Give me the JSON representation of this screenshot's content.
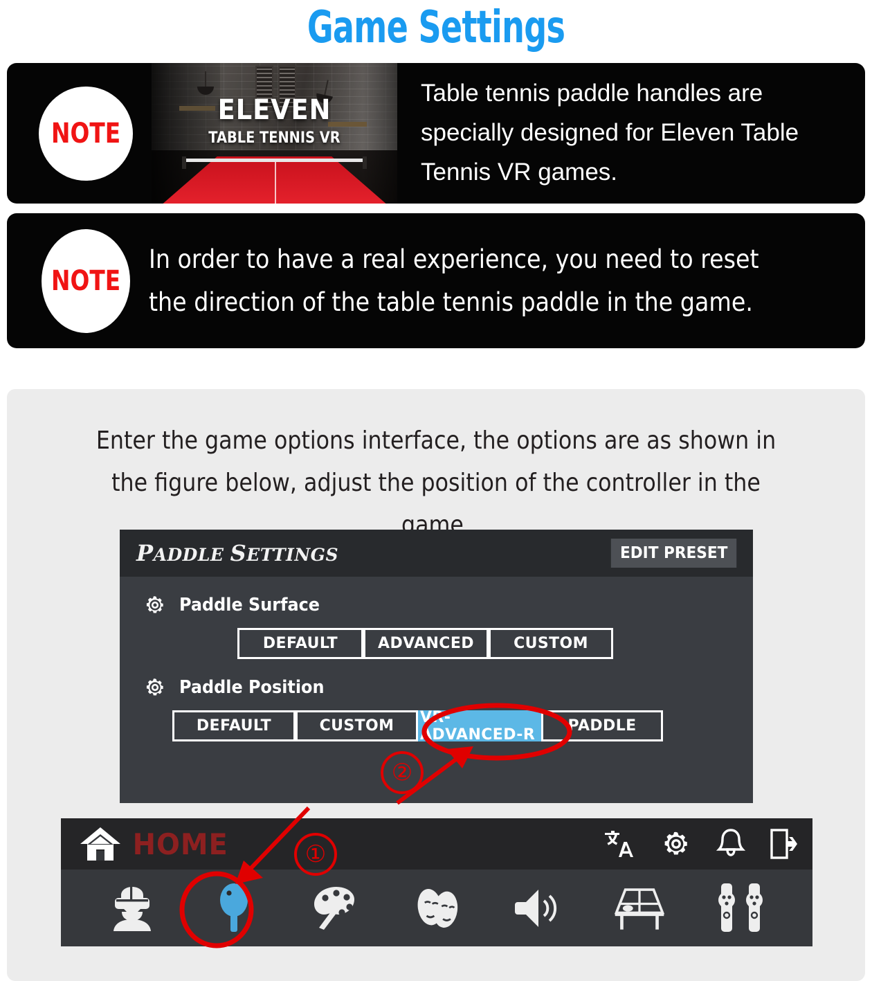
{
  "title": "Game Settings",
  "title_color": "#1a9bf0",
  "notes": [
    {
      "badge": "NOTE",
      "thumbnail": {
        "title": "ELEVEN",
        "subtitle": "TABLE TENNIS VR"
      },
      "text": "Table tennis paddle handles are specially designed for Eleven Table Tennis VR games."
    },
    {
      "badge": "NOTE",
      "text": "In order to have a real experience, you need to reset the direction of the table tennis paddle in the game."
    }
  ],
  "intro_text": "Enter the game options interface, the options are as shown in the figure below, adjust the position of the controller in the game.",
  "panel": {
    "title_part1": "P",
    "title_part2": "ADDLE ",
    "title_part3": "S",
    "title_part4": "ETTINGS",
    "title_full": "PADDLE SETTINGS",
    "edit_preset": "EDIT PRESET",
    "rows": [
      {
        "icon": "gear-icon",
        "label": "Paddle Surface",
        "options": [
          {
            "label": "DEFAULT",
            "selected": false
          },
          {
            "label": "ADVANCED",
            "selected": false
          },
          {
            "label": "CUSTOM",
            "selected": false
          }
        ]
      },
      {
        "icon": "gear-icon",
        "label": "Paddle Position",
        "options": [
          {
            "label": "DEFAULT",
            "selected": false
          },
          {
            "label": "CUSTOM",
            "selected": false
          },
          {
            "label": "VR-ADVANCED-R",
            "selected": true
          },
          {
            "label": "PADDLE",
            "selected": false
          }
        ]
      }
    ],
    "selected_color": "#5cb8e6"
  },
  "homebar": {
    "home_label": "HOME",
    "home_label_color": "#8d2020",
    "top_icons": [
      "translate-icon",
      "gear-icon",
      "bell-icon",
      "exit-icon"
    ],
    "bottom_icons": [
      "vr-avatar-icon",
      "paddle-icon",
      "palette-icon",
      "theater-masks-icon",
      "speaker-icon",
      "table-tennis-table-icon",
      "vr-controllers-icon"
    ],
    "paddle_icon_color": "#4aa8dd"
  },
  "annotations": {
    "marker_1": "①",
    "marker_2": "②",
    "color": "#e00000"
  }
}
